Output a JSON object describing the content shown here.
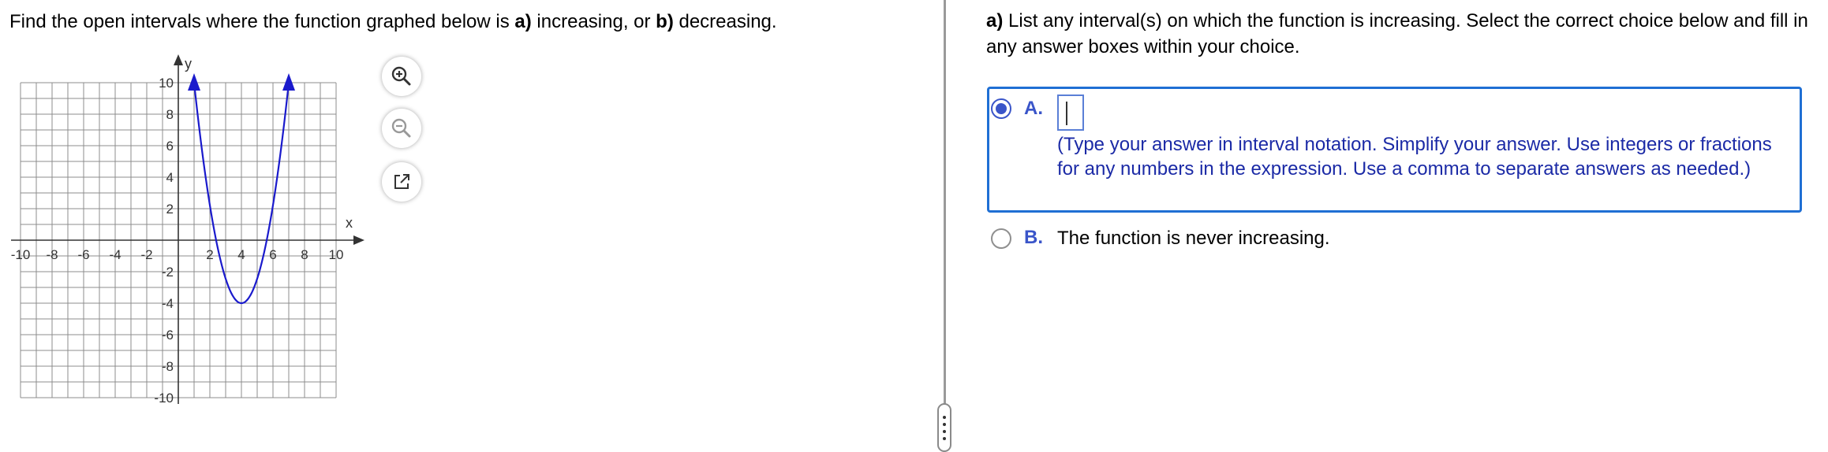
{
  "question": {
    "part1": "Find the open intervals where the function graphed below is ",
    "a_label": "a)",
    "part2": " increasing, or ",
    "b_label": "b)",
    "part3": " decreasing."
  },
  "graph": {
    "axis_x_label": "x",
    "axis_y_label": "y",
    "x_range": [
      -10,
      10
    ],
    "y_range": [
      -10,
      10
    ],
    "x_ticks": [
      "-10",
      "-8",
      "-6",
      "-4",
      "-2",
      "2",
      "4",
      "6",
      "8",
      "10"
    ],
    "y_ticks": [
      "10",
      "8",
      "6",
      "4",
      "2",
      "-2",
      "-4",
      "-6",
      "-8",
      "-10"
    ],
    "curve_color": "#1a1acc",
    "vertex": [
      4,
      -4
    ],
    "top_points": [
      [
        1,
        10
      ],
      [
        7,
        10
      ]
    ]
  },
  "tools": {
    "zoom_in": "zoom-in-icon",
    "zoom_out": "zoom-out-icon",
    "popout": "popout-icon"
  },
  "part_a": {
    "prompt_label": "a)",
    "prompt_text": " List any interval(s) on which the function is increasing. Select the correct choice below and fill in any answer boxes within your choice.",
    "choice_a": {
      "letter": "A.",
      "input_value": "",
      "instructions": "(Type your answer in interval notation. Simplify your answer. Use integers or fractions for any numbers in the expression. Use a comma to separate answers as needed.)",
      "selected": true
    },
    "choice_b": {
      "letter": "B.",
      "text": "The function is never increasing.",
      "selected": false
    }
  },
  "colors": {
    "accent": "#3a55c9",
    "selected_border": "#1f6fd4",
    "instruction_text": "#1b2aa6"
  }
}
